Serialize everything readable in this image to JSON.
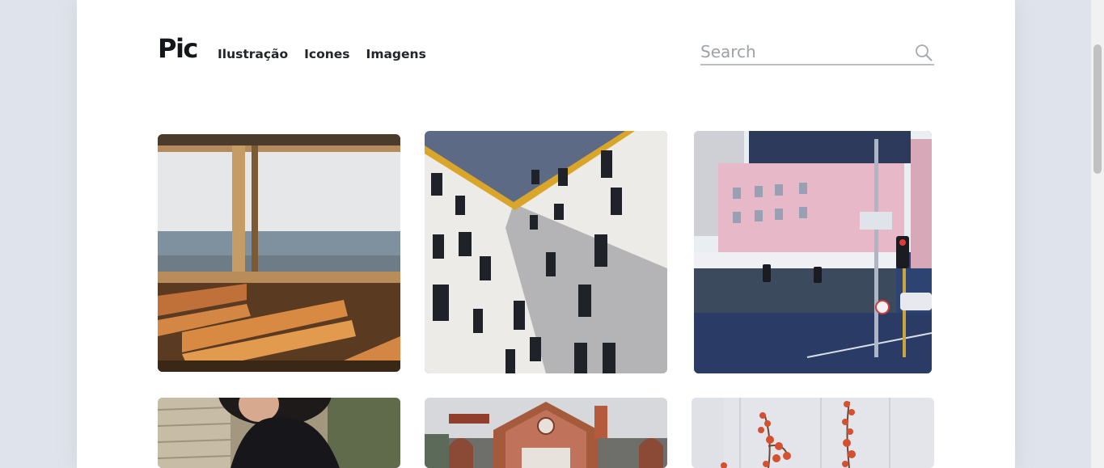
{
  "brand": {
    "logo_text": "Pic"
  },
  "nav": {
    "items": [
      "Ilustração",
      "Icones",
      "Imagens"
    ]
  },
  "search": {
    "placeholder": "Search",
    "icon": "search-icon"
  },
  "gallery": {
    "photos": [
      "ferry-window-benches-sea",
      "white-building-yellow-trim",
      "pink-building-street-traffic-lights",
      "woman-dark-clothes-green-wall",
      "ornate-brick-building-facade",
      "red-berries-branch-white"
    ]
  },
  "colors": {
    "page_bg": "#ffffff",
    "outer_bg": "#dfe4ec",
    "text": "#22242a"
  }
}
